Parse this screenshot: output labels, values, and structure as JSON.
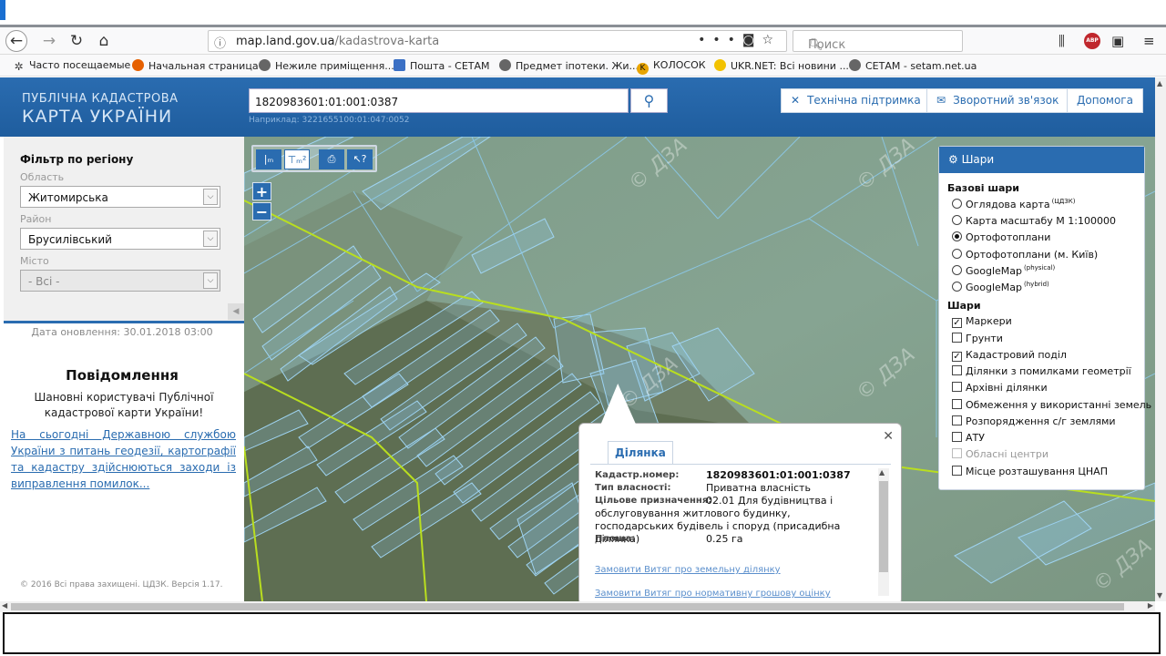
{
  "browser": {
    "url_host": "map.land.gov.ua",
    "url_path": "/kadastrova-karta",
    "search_placeholder": "Поиск",
    "bookmarks": [
      {
        "label": "Часто посещаемые",
        "icon": "star-gear-icon"
      },
      {
        "label": "Начальная страница",
        "icon": "firefox-icon"
      },
      {
        "label": "Нежиле приміщення...",
        "icon": "globe-icon"
      },
      {
        "label": "Пошта - СЕТАМ",
        "icon": "mail-icon"
      },
      {
        "label": "Предмет іпотеки. Жи...",
        "icon": "globe-icon"
      },
      {
        "label": "КОЛОСОК",
        "icon": "k-icon"
      },
      {
        "label": "UKR.NET: Всі новини ...",
        "icon": "sun-icon"
      },
      {
        "label": "СЕТАМ - setam.net.ua",
        "icon": "globe-icon"
      }
    ]
  },
  "header": {
    "logo_line1": "ПУБЛІЧНА КАДАСТРОВА",
    "logo_line2": "КАРТА УКРАЇНИ",
    "search_value": "1820983601:01:001:0387",
    "search_example": "Наприклад: 3221655100:01:047:0052",
    "buttons": {
      "support": "Технічна підтримка",
      "feedback": "Зворотний зв'язок",
      "help": "Допомога"
    }
  },
  "sidebar": {
    "filter_title": "Фільтр по регіону",
    "region_label": "Область",
    "region_value": "Житомирська",
    "district_label": "Район",
    "district_value": "Брусилівський",
    "city_label": "Місто",
    "city_value": "- Всі -",
    "updated": "Дата оновлення: 30.01.2018 03:00",
    "notice_title": "Повідомлення",
    "notice_text": "Шановні користувачі Публічної кадастрової карти України!",
    "notice_link": "На сьогодні Державною службою України з питань геодезії, картографії та кадастру здійснюються заходи із виправлення помилок...",
    "copyright": "© 2016 Всі права захищені. ЦДЗК. Версія 1.17."
  },
  "map": {
    "watermark": "© ДЗА",
    "layers": {
      "title": "Шари",
      "base_title": "Базові шари",
      "base": [
        {
          "label": "Оглядова карта",
          "sup": "(ЦДЗК)",
          "selected": false
        },
        {
          "label": "Карта масштабу М 1:100000",
          "sup": "",
          "selected": false
        },
        {
          "label": "Ортофотоплани",
          "sup": "",
          "selected": true
        },
        {
          "label": "Ортофотоплани (м. Київ)",
          "sup": "",
          "selected": false
        },
        {
          "label": "GoogleMap",
          "sup": "(physical)",
          "selected": false
        },
        {
          "label": "GoogleMap",
          "sup": "(hybrid)",
          "selected": false
        }
      ],
      "overlay_title": "Шари",
      "overlays": [
        {
          "label": "Маркери",
          "checked": true,
          "disabled": false
        },
        {
          "label": "Грунти",
          "checked": false,
          "disabled": false
        },
        {
          "label": "Кадастровий поділ",
          "checked": true,
          "disabled": false
        },
        {
          "label": "Ділянки з помилками геометрії",
          "checked": false,
          "disabled": false
        },
        {
          "label": "Архівні ділянки",
          "checked": false,
          "disabled": false
        },
        {
          "label": "Обмеження у використанні земель",
          "checked": false,
          "disabled": false
        },
        {
          "label": "Розпорядження с/г землями",
          "checked": false,
          "disabled": false
        },
        {
          "label": "АТУ",
          "checked": false,
          "disabled": false
        },
        {
          "label": "Обласні центри",
          "checked": false,
          "disabled": true
        },
        {
          "label": "Місце розташування ЦНАП",
          "checked": false,
          "disabled": false
        }
      ]
    },
    "popup": {
      "tab": "Ділянка",
      "cad_label": "Кадастр.номер:",
      "cad_value": "1820983601:01:001:0387",
      "own_label": "Тип власності:",
      "own_value": "Приватна власність",
      "purpose_label": "Цільове призначення:",
      "purpose_value_1": "02.01 Для будівництва і",
      "purpose_value_rest": "обслуговування житлового будинку, господарських будівель і споруд (присадибна ділянка)",
      "area_label": "Площа:",
      "area_value": "0.25 га",
      "link1": "Замовити Витяг про земельну ділянку",
      "link2": "Замовити Витяг про нормативну грошову оцінку"
    }
  }
}
